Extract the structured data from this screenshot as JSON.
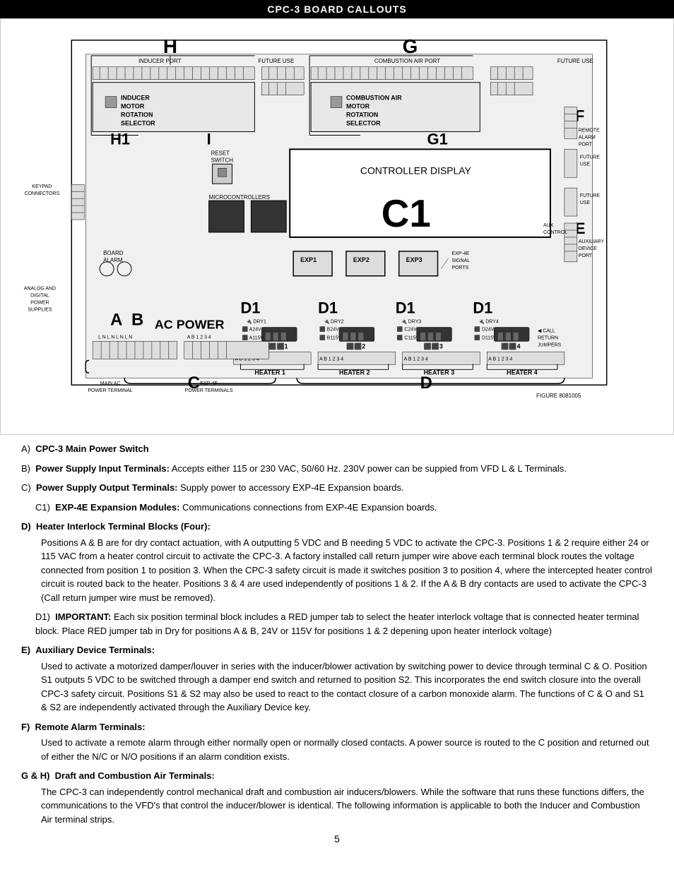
{
  "header": {
    "title": "CPC-3 BOARD CALLOUTS"
  },
  "diagram": {
    "labels": {
      "H": "H",
      "G": "G",
      "H1": "H1",
      "G1": "G1",
      "F": "F",
      "E": "E",
      "C1": "C1",
      "A": "A",
      "B": "B",
      "C": "C",
      "D": "D",
      "D1_1": "D1",
      "D1_2": "D1",
      "D1_3": "D1",
      "D1_4": "D1"
    },
    "callouts": {
      "inducer_port": "INDUCER PORT",
      "combustion_air_port": "COMBUSTION AIR PORT",
      "future_use_1": "FUTURE USE",
      "future_use_2": "FUTURE USE",
      "future_use_3": "FUTURE USE",
      "future_use_4": "FUTURE USE",
      "inducer_motor": "INDUCER\nMOTOR\nROTATION\nSELECTOR",
      "combustion_air_motor": "COMBUSTION AIR\nMOTOR\nROTATION\nSELECTOR",
      "remote_alarm_port": "REMOTE\nALARM\nPORT",
      "auxiliary_device_port": "AUXILIARY\nDEVICE\nPORT",
      "reset_switch": "RESET\nSWITCH",
      "microcontrollers": "MICROCONTROLLERS",
      "keypad_connectors": "KEYPAD\nCONNECTORS",
      "board_alarm": "BOARD\nALARM",
      "controller_display": "CONTROLLER DISPLAY",
      "exp1": "EXP1",
      "exp2": "EXP2",
      "exp3": "EXP3",
      "exp4e_signal": "EXP-4E\nSIGNAL\nPORTS",
      "analog_digital": "ANALOG AND\nDIGITAL\nPOWER\nSUPPLIES",
      "ac_power": "AC POWER",
      "dry1": "DRY1",
      "dry2": "DRY2",
      "dry3": "DRY3",
      "dry4": "DRY4",
      "a24v": "A24V",
      "b24v": "B24V",
      "c24v": "C24V",
      "d24v": "D24V",
      "a115v": "A115V",
      "b115v": "B115V",
      "c115v": "C115V",
      "d115v": "D115V",
      "heater1": "HEATER 1",
      "heater2": "HEATER 2",
      "heater3": "HEATER 3",
      "heater4": "HEATER 4",
      "main_ac_power_terminal": "MAIN AC\nPOWER TERMINAL",
      "exp4e_power_terminals": "EXP-4E\nPOWER TERMINALS",
      "call_return_jumpers": "CALL\nRETURN\nJUMPERS",
      "figure": "FIGURE 8081005"
    }
  },
  "descriptions": [
    {
      "id": "A",
      "letter": "A)",
      "bold_text": "CPC-3 Main Power Switch",
      "text": ""
    },
    {
      "id": "B",
      "letter": "B)",
      "bold_text": "Power Supply Input Terminals:",
      "text": " Accepts either 115 or 230 VAC, 50/60 Hz. 230V power can be suppied from VFD L & L Terminals."
    },
    {
      "id": "C",
      "letter": "C)",
      "bold_text": "Power Supply Output Terminals:",
      "text": " Supply power to accessory EXP-4E Expansion boards."
    },
    {
      "id": "C1",
      "letter": "C1)",
      "bold_text": "EXP-4E Expansion Modules:",
      "text": " Communications connections from EXP-4E Expansion boards.",
      "indent": true
    },
    {
      "id": "D",
      "letter": "D)",
      "bold_text": "Heater Interlock Terminal Blocks (Four):",
      "text": "\nPositions A & B are for dry contact actuation, with A outputting 5 VDC and B needing 5 VDC to activate the CPC-3. Positions 1 & 2 require either 24 or 115 VAC from a heater control circuit to activate the CPC-3. A factory installed call return jumper wire above each terminal block routes the voltage connected from position 1 to position 3. When the CPC-3 safety circuit is made it switches position 3 to position 4, where the intercepted heater control circuit is routed back to the heater. Positions 3 & 4 are used independently of positions 1 & 2. If the A & B dry contacts are used to activate the CPC-3 (Call return jumper wire must be removed).",
      "is_bold_header": true
    },
    {
      "id": "D1",
      "letter": "D1)",
      "bold_text": "IMPORTANT:",
      "text": " Each six position terminal block includes a RED jumper tab to select the heater interlock voltage that is connected heater terminal block. Place RED jumper tab in Dry for positions A & B, 24V or 115V for positions 1 & 2 depening upon heater interlock voltage)",
      "indent": true
    },
    {
      "id": "E",
      "letter": "E)",
      "bold_text": "Auxiliary Device Terminals:",
      "text": "\n    Used to activate a motorized damper/louver in series with the inducer/blower activation by switching power to device through terminal C & O. Position S1 outputs 5 VDC to be switched through a damper end switch and returned to position S2. This incorporates the end switch closure into the overall CPC-3 safety circuit. Positions S1 & S2 may also be used to react to the contact closure of a carbon monoxide alarm. The functions of C & O and S1 & S2 are independently activated through the Auxiliary Device key.",
      "is_bold_header": true
    },
    {
      "id": "F",
      "letter": "F)",
      "bold_text": "Remote Alarm Terminals:",
      "text": "\n    Used to activate a remote alarm through either normally open or normally closed contacts. A power source is routed to the C position and returned out of either the N/C or N/O positions if an alarm condition exists.",
      "is_bold_header": true
    },
    {
      "id": "GH",
      "letter": "G & H)",
      "bold_text": "Draft and Combustion Air Terminals:",
      "text": "\n    The CPC-3 can independently control mechanical draft and combustion air inducers/blowers. While the software that runs these functions differs, the communications to the VFD's that control the inducer/blower is identical. The following information is applicable to both the Inducer and Combustion Air terminal strips.",
      "is_bold_header": true,
      "label_prefix": "G & H)\t"
    }
  ],
  "page_number": "5"
}
